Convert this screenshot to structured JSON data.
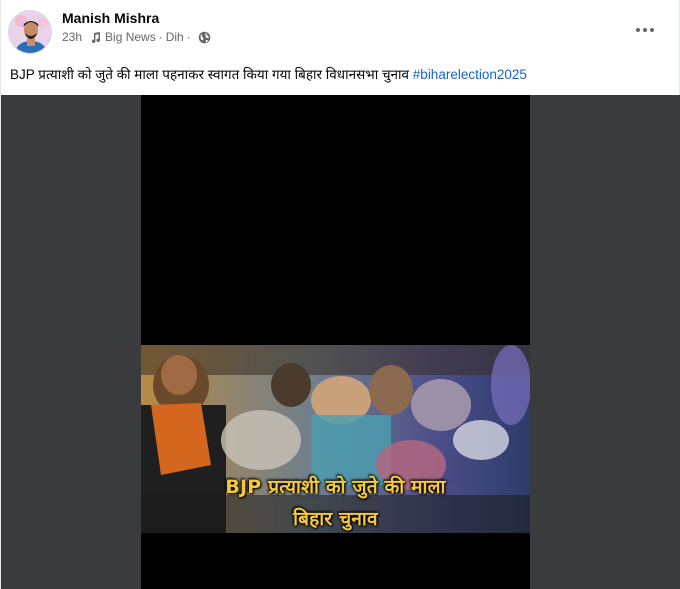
{
  "post": {
    "author": "Manish Mishra",
    "time": "23h",
    "group": "Big News",
    "location": "Dih",
    "meta_separator": "·",
    "caption_text": "BJP प्रत्याशी को जुते की माला पहनाकर स्वागत किया गया बिहार विधानसभा चुनाव",
    "hashtag": "#biharelection2025"
  },
  "video": {
    "overlay_line1": "BJP प्रत्याशी को जुते की माला",
    "overlay_line2": "बिहार चुनाव"
  },
  "icons": {
    "more": "more-options-icon",
    "music": "music-note-icon",
    "globe": "globe-icon"
  },
  "colors": {
    "hashtag": "#1464cc",
    "overlay_text": "#f4c83a",
    "media_background": "#3a3b3c",
    "meta_text": "#65676b"
  }
}
